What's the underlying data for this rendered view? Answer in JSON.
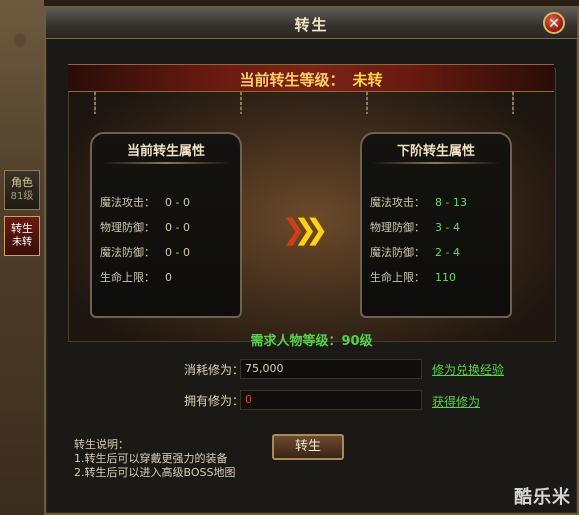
{
  "side_tabs": [
    {
      "label": "角色",
      "sub": "81级"
    },
    {
      "label": "转生",
      "sub": "未转"
    }
  ],
  "window": {
    "title": "转生",
    "close_label": "ⓧ"
  },
  "level": {
    "label": "当前转生等级：",
    "value": "未转"
  },
  "panel_current": {
    "title": "当前转生属性",
    "rows": [
      {
        "name": "魔法攻击：",
        "value": "0 - 0"
      },
      {
        "name": "物理防御：",
        "value": "0 - 0"
      },
      {
        "name": "魔法防御：",
        "value": "0 - 0"
      },
      {
        "name": "生命上限：",
        "value": "0"
      }
    ]
  },
  "panel_next": {
    "title": "下阶转生属性",
    "rows": [
      {
        "name": "魔法攻击：",
        "value": "8 - 13"
      },
      {
        "name": "物理防御：",
        "value": "3 - 4"
      },
      {
        "name": "魔法防御：",
        "value": "2 - 4"
      },
      {
        "name": "生命上限：",
        "value": "110"
      }
    ]
  },
  "required": "需求人物等级：90级",
  "cost": {
    "label": "消耗修为：",
    "value": "75,000",
    "link": "修为兑换经验"
  },
  "owned": {
    "label": "拥有修为：",
    "value": "0",
    "link": "获得修为"
  },
  "action_button": "转生",
  "notes": [
    "转生说明：",
    "1.转生后可以穿戴更强力的装备",
    "2.转生后可以进入高级BOSS地图"
  ],
  "watermark": "酷乐米",
  "colors": {
    "accent_gold": "#ffcc66",
    "green": "#56d14a",
    "red": "#e04030"
  }
}
